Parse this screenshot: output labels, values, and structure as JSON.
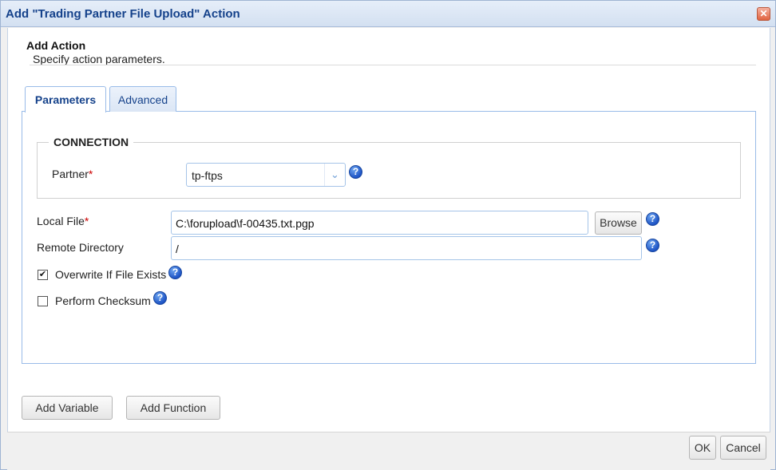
{
  "dialog": {
    "title": "Add \"Trading Partner File Upload\" Action",
    "close_glyph": "✕"
  },
  "header": {
    "title": "Add Action",
    "subtitle": "Specify action parameters."
  },
  "tabs": [
    {
      "label": "Parameters",
      "active": true
    },
    {
      "label": "Advanced",
      "active": false
    }
  ],
  "connection": {
    "legend": "CONNECTION",
    "partner_label": "Partner",
    "partner_value": "tp-ftps",
    "required_mark": "*"
  },
  "fields": {
    "local_file_label": "Local File",
    "local_file_value": "C:\\forupload\\f-00435.txt.pgp",
    "browse_label": "Browse",
    "remote_dir_label": "Remote Directory",
    "remote_dir_value": "/",
    "required_mark": "*"
  },
  "options": {
    "overwrite_label": "Overwrite If File Exists",
    "overwrite_checked": true,
    "checksum_label": "Perform Checksum",
    "checksum_checked": false
  },
  "buttons": {
    "add_variable": "Add Variable",
    "add_function": "Add Function",
    "ok": "OK",
    "cancel": "Cancel"
  },
  "icons": {
    "help": "?",
    "chevron": "⌄",
    "check": "✔"
  }
}
